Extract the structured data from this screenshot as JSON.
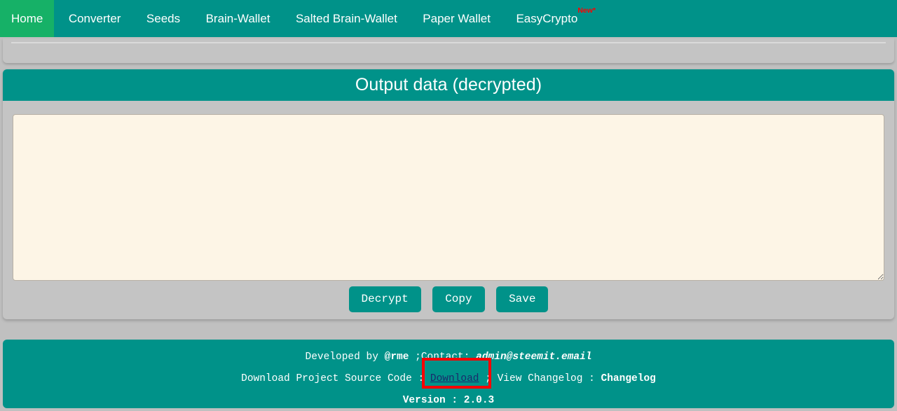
{
  "nav": {
    "items": [
      {
        "label": "Home",
        "active": true,
        "badge": ""
      },
      {
        "label": "Converter",
        "active": false,
        "badge": ""
      },
      {
        "label": "Seeds",
        "active": false,
        "badge": ""
      },
      {
        "label": "Brain-Wallet",
        "active": false,
        "badge": ""
      },
      {
        "label": "Salted Brain-Wallet",
        "active": false,
        "badge": ""
      },
      {
        "label": "Paper Wallet",
        "active": false,
        "badge": ""
      },
      {
        "label": "EasyCrypto",
        "active": false,
        "badge": "New*"
      }
    ]
  },
  "main": {
    "header_title": "Output data (decrypted)",
    "textarea": {
      "value": "",
      "placeholder": ""
    },
    "buttons": [
      {
        "label": "Decrypt"
      },
      {
        "label": "Copy"
      },
      {
        "label": "Save"
      }
    ]
  },
  "footer": {
    "line1": {
      "pre": "Developed by ",
      "handle": "@rme",
      "mid": " ;Contact: ",
      "email": "admin@steemit.email"
    },
    "line2": {
      "pre": "Download Project Source Code : ",
      "link": "Download",
      "mid": " ; View Changelog : ",
      "changelog": "Changelog"
    },
    "line3": "Version : 2.0.3"
  },
  "colors": {
    "teal": "#009289",
    "active_green": "#16b167",
    "page_bg": "#c0c0c0",
    "panel_bg": "#c4c4c4",
    "textarea_bg": "#fdf5e6",
    "badge_red": "#ff0000",
    "link_navy": "#1a2a6c",
    "annotation_red": "#ff0000"
  }
}
